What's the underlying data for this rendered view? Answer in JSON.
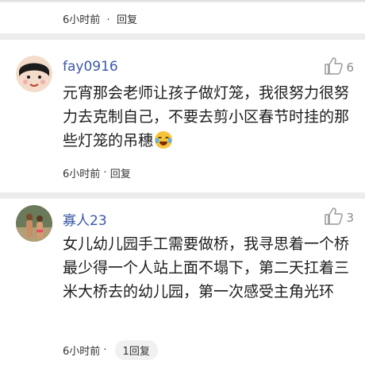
{
  "previous": {
    "time": "6小时前",
    "reply": "回复"
  },
  "comments": [
    {
      "username": "fay0916",
      "likes": "6",
      "text": "元宵那会老师让孩子做灯笼，我很努力很努力去克制自己，不要去剪小区春节时挂的那些灯笼的吊穗",
      "emoji": "laughing-crying-emoji",
      "time": "6小时前",
      "reply": "回复"
    },
    {
      "username": "寡人23",
      "likes": "3",
      "text": "女儿幼儿园手工需要做桥，我寻思着一个桥最少得一个人站上面不塌下，第二天扛着三米大桥去的幼儿园，第一次感受主角光环",
      "time": "6小时前",
      "reply_count_label": "1回复"
    }
  ],
  "icons": {
    "like": "thumbs-up-icon"
  },
  "colors": {
    "username": "#3b57a6",
    "divider": "#ececec"
  }
}
